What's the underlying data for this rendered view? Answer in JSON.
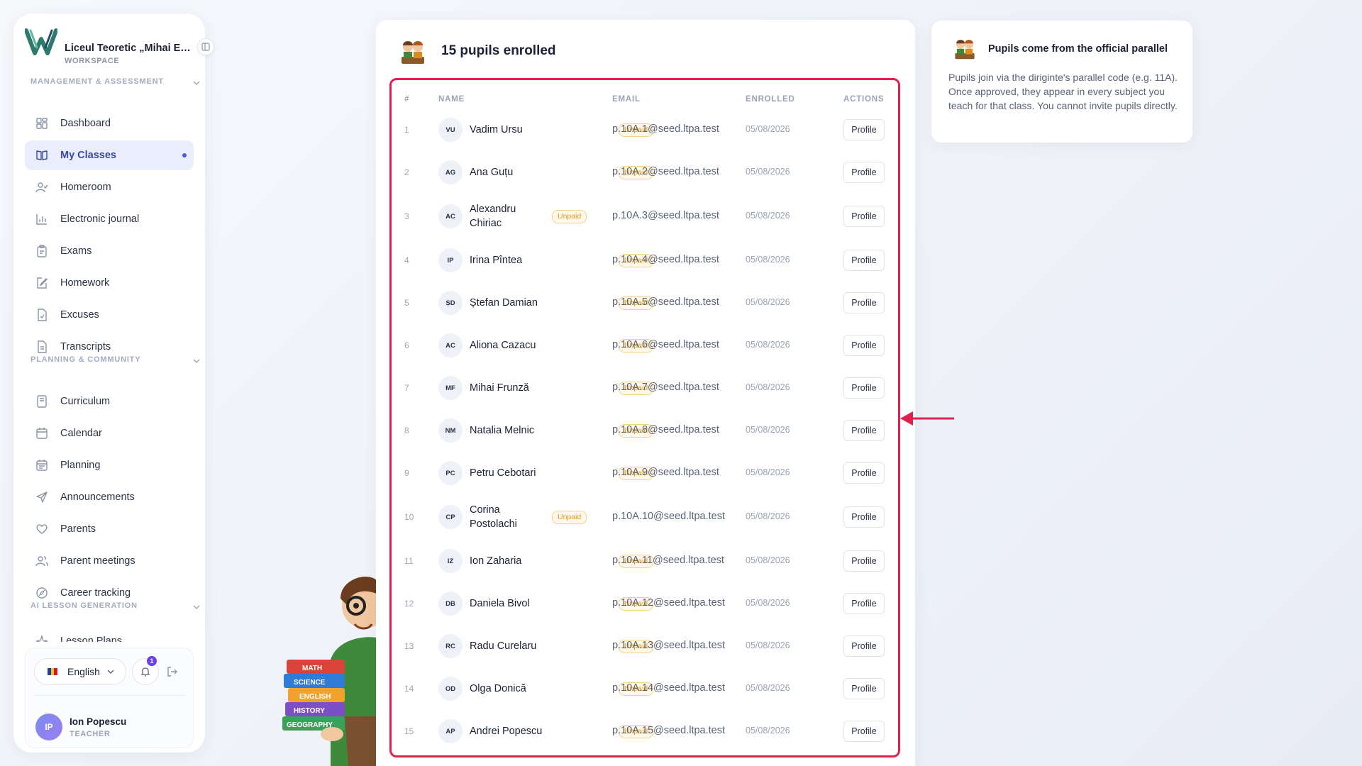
{
  "sidebar": {
    "school_name": "Liceul Teoretic „Mihai Emi...",
    "workspace_label": "WORKSPACE",
    "sections": [
      {
        "title": "MANAGEMENT & ASSESSMENT"
      },
      {
        "title": "PLANNING & COMMUNITY"
      },
      {
        "title": "AI LESSON GENERATION"
      }
    ],
    "items": [
      {
        "label": "Dashboard",
        "icon": "dashboard-icon"
      },
      {
        "label": "My Classes",
        "icon": "book-icon",
        "active": true
      },
      {
        "label": "Homeroom",
        "icon": "user-check-icon"
      },
      {
        "label": "Electronic journal",
        "icon": "bar-chart-icon"
      },
      {
        "label": "Exams",
        "icon": "clipboard-icon"
      },
      {
        "label": "Homework",
        "icon": "edit-icon"
      },
      {
        "label": "Excuses",
        "icon": "file-check-icon"
      },
      {
        "label": "Transcripts",
        "icon": "file-text-icon"
      },
      {
        "label": "Curriculum",
        "icon": "book-open-icon"
      },
      {
        "label": "Calendar",
        "icon": "calendar-icon"
      },
      {
        "label": "Planning",
        "icon": "calendar-planning-icon"
      },
      {
        "label": "Announcements",
        "icon": "send-icon"
      },
      {
        "label": "Parents",
        "icon": "heart-icon"
      },
      {
        "label": "Parent meetings",
        "icon": "users-icon"
      },
      {
        "label": "Career tracking",
        "icon": "compass-icon"
      },
      {
        "label": "Lesson Plans",
        "icon": "sparkle-icon"
      }
    ],
    "footer": {
      "language": "English",
      "notifications_count": "1",
      "user_initials": "IP",
      "user_name": "Ion Popescu",
      "user_role": "TEACHER"
    }
  },
  "main": {
    "title": "15 pupils enrolled",
    "columns": {
      "num": "#",
      "name": "NAME",
      "email": "EMAIL",
      "enrolled": "ENROLLED",
      "actions": "ACTIONS"
    },
    "status_label": "Unpaid",
    "action_label": "Profile",
    "pupils": [
      {
        "num": "1",
        "initials": "VU",
        "name": "Vadim Ursu",
        "email": "p.10A.1@seed.ltpa.test",
        "enrolled": "05/08/2026"
      },
      {
        "num": "2",
        "initials": "AG",
        "name": "Ana Guțu",
        "email": "p.10A.2@seed.ltpa.test",
        "enrolled": "05/08/2026"
      },
      {
        "num": "3",
        "initials": "AC",
        "name": "Alexandru Chiriac",
        "email": "p.10A.3@seed.ltpa.test",
        "enrolled": "05/08/2026"
      },
      {
        "num": "4",
        "initials": "IP",
        "name": "Irina Pîntea",
        "email": "p.10A.4@seed.ltpa.test",
        "enrolled": "05/08/2026"
      },
      {
        "num": "5",
        "initials": "ȘD",
        "name": "Ștefan Damian",
        "email": "p.10A.5@seed.ltpa.test",
        "enrolled": "05/08/2026"
      },
      {
        "num": "6",
        "initials": "AC",
        "name": "Aliona Cazacu",
        "email": "p.10A.6@seed.ltpa.test",
        "enrolled": "05/08/2026"
      },
      {
        "num": "7",
        "initials": "MF",
        "name": "Mihai Frunză",
        "email": "p.10A.7@seed.ltpa.test",
        "enrolled": "05/08/2026"
      },
      {
        "num": "8",
        "initials": "NM",
        "name": "Natalia Melnic",
        "email": "p.10A.8@seed.ltpa.test",
        "enrolled": "05/08/2026"
      },
      {
        "num": "9",
        "initials": "PC",
        "name": "Petru Cebotari",
        "email": "p.10A.9@seed.ltpa.test",
        "enrolled": "05/08/2026"
      },
      {
        "num": "10",
        "initials": "CP",
        "name": "Corina Postolachi",
        "email": "p.10A.10@seed.ltpa.test",
        "enrolled": "05/08/2026"
      },
      {
        "num": "11",
        "initials": "IZ",
        "name": "Ion Zaharia",
        "email": "p.10A.11@seed.ltpa.test",
        "enrolled": "05/08/2026"
      },
      {
        "num": "12",
        "initials": "DB",
        "name": "Daniela Bivol",
        "email": "p.10A.12@seed.ltpa.test",
        "enrolled": "05/08/2026"
      },
      {
        "num": "13",
        "initials": "RC",
        "name": "Radu Curelaru",
        "email": "p.10A.13@seed.ltpa.test",
        "enrolled": "05/08/2026"
      },
      {
        "num": "14",
        "initials": "OD",
        "name": "Olga Donică",
        "email": "p.10A.14@seed.ltpa.test",
        "enrolled": "05/08/2026"
      },
      {
        "num": "15",
        "initials": "AP",
        "name": "Andrei Popescu",
        "email": "p.10A.15@seed.ltpa.test",
        "enrolled": "05/08/2026"
      }
    ]
  },
  "info": {
    "title": "Pupils come from the official parallel",
    "body": "Pupils join via the diriginte's parallel code (e.g. 11A). Once approved, they appear in every subject you teach for that class. You cannot invite pupils directly."
  },
  "mascot_books": [
    "MATH",
    "SCIENCE",
    "ENGLISH",
    "HISTORY",
    "GEOGRAPHY"
  ],
  "colors": {
    "accent": "#4c5cd6",
    "highlight": "#e21f4e",
    "unpaid": "#e39b1b"
  }
}
